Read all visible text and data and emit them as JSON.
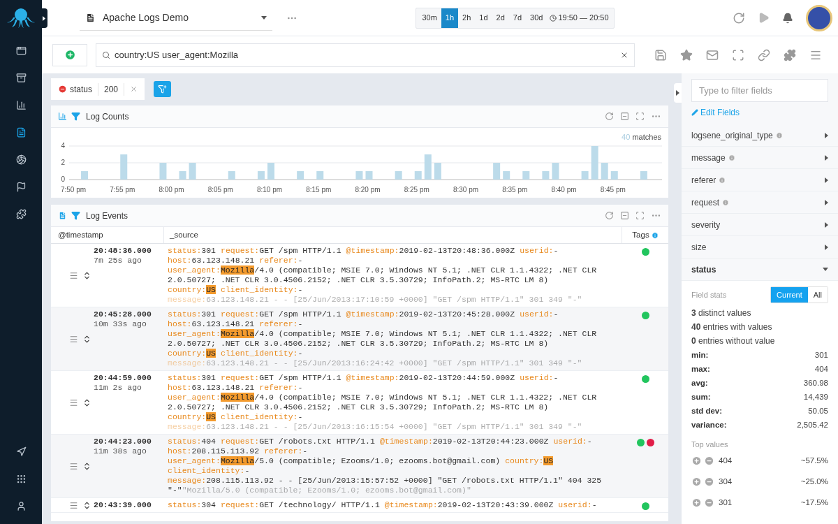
{
  "nav_top": [
    {
      "selected": false
    },
    {
      "selected": false
    },
    {
      "selected": false
    },
    {
      "selected": true
    },
    {
      "selected": false
    },
    {
      "selected": false
    },
    {
      "selected": false
    }
  ],
  "nav_bottom": [
    {
      "selected": false
    },
    {
      "selected": false
    },
    {
      "selected": false
    }
  ],
  "dashboard": {
    "title": "Apache Logs Demo"
  },
  "time_ranges": [
    {
      "label": "30m",
      "selected": false
    },
    {
      "label": "1h",
      "selected": true
    },
    {
      "label": "2h",
      "selected": false
    },
    {
      "label": "1d",
      "selected": false
    },
    {
      "label": "2d",
      "selected": false
    },
    {
      "label": "7d",
      "selected": false
    },
    {
      "label": "30d",
      "selected": false
    }
  ],
  "time_window": "19:50 — 20:50",
  "search": {
    "value": "country:US user_agent:Mozilla"
  },
  "filters": [
    {
      "field": "status",
      "value": "200",
      "excluded": true
    }
  ],
  "log_counts": {
    "title": "Log Counts",
    "matches_count": "40",
    "matches_label": "matches",
    "chart_data": {
      "type": "bar",
      "categories": [
        "7:50 pm",
        null,
        null,
        null,
        null,
        "7:55 pm",
        null,
        null,
        null,
        null,
        "8:00 pm",
        null,
        null,
        null,
        null,
        "8:05 pm",
        null,
        null,
        null,
        null,
        "8:10 pm",
        null,
        null,
        null,
        null,
        "8:15 pm",
        null,
        null,
        null,
        null,
        "8:20 pm",
        null,
        null,
        null,
        null,
        "8:25 pm",
        null,
        null,
        null,
        null,
        "8:30 pm",
        null,
        null,
        null,
        null,
        "8:35 pm",
        null,
        null,
        null,
        null,
        "8:40 pm",
        null,
        null,
        null,
        null,
        "8:45 pm",
        null,
        null,
        null,
        null
      ],
      "values": [
        0,
        1,
        0,
        0,
        0,
        3,
        0,
        0,
        0,
        2,
        0,
        1,
        2,
        0,
        0,
        0,
        1,
        0,
        0,
        1,
        2,
        0,
        0,
        1,
        0,
        1,
        0,
        0,
        0,
        1,
        1,
        0,
        0,
        1,
        0,
        1,
        3,
        2,
        0,
        0,
        0,
        0,
        0,
        2,
        1,
        0,
        1,
        0,
        1,
        2,
        0,
        0,
        1,
        4,
        2,
        1,
        0,
        0,
        1,
        0
      ],
      "ylim": [
        0,
        4
      ],
      "yticks": [
        0,
        2,
        4
      ]
    }
  },
  "log_events": {
    "title": "Log Events",
    "columns": [
      "@timestamp",
      "_source",
      "Tags"
    ],
    "rows": [
      {
        "time": "20:48:36.000",
        "ago": "7m 25s ago",
        "tags": [
          {
            "color": "#22c55e"
          }
        ],
        "fields": [
          {
            "key": "status:",
            "parts": [
              {
                "text": "301"
              }
            ]
          },
          {
            "key": "request:",
            "parts": [
              {
                "text": "GET /spm HTTP/1.1"
              }
            ]
          },
          {
            "key": "@timestamp:",
            "parts": [
              {
                "text": "2019-02-13T20:48:36.000Z"
              }
            ]
          },
          {
            "key": "userid:",
            "parts": [
              {
                "text": "-"
              }
            ]
          },
          {
            "key": "host:",
            "parts": [
              {
                "text": "63.123.148.21"
              }
            ]
          },
          {
            "key": "referer:",
            "parts": [
              {
                "text": "-"
              }
            ]
          },
          {
            "key": "user_agent:",
            "parts": [
              {
                "text": "Mozilla",
                "highlighted": true
              },
              {
                "text": "/4.0 (compatible; MSIE 7.0; Windows NT 5.1; .NET CLR 1.1.4322; .NET CLR 2.0.50727; .NET CLR 3.0.4506.2152; .NET CLR 3.5.30729; InfoPath.2; MS-RTC LM 8)"
              }
            ]
          },
          {
            "key": "country:",
            "parts": [
              {
                "text": "US",
                "highlighted": true
              }
            ]
          },
          {
            "key": "client_identity:",
            "parts": [
              {
                "text": "-"
              }
            ]
          },
          {
            "key": "message:",
            "faded": true,
            "parts": [
              {
                "text": "63.123.148.21 - - [25/Jun/2013:17:10:59 +0000] \"GET /spm HTTP/1.1\" 301 349 \"-\""
              }
            ]
          }
        ]
      },
      {
        "time": "20:45:28.000",
        "ago": "10m 33s ago",
        "tags": [
          {
            "color": "#22c55e"
          }
        ],
        "fields": [
          {
            "key": "status:",
            "parts": [
              {
                "text": "301"
              }
            ]
          },
          {
            "key": "request:",
            "parts": [
              {
                "text": "GET /spm HTTP/1.1"
              }
            ]
          },
          {
            "key": "@timestamp:",
            "parts": [
              {
                "text": "2019-02-13T20:45:28.000Z"
              }
            ]
          },
          {
            "key": "userid:",
            "parts": [
              {
                "text": "-"
              }
            ]
          },
          {
            "key": "host:",
            "parts": [
              {
                "text": "63.123.148.21"
              }
            ]
          },
          {
            "key": "referer:",
            "parts": [
              {
                "text": "-"
              }
            ]
          },
          {
            "key": "user_agent:",
            "parts": [
              {
                "text": "Mozilla",
                "highlighted": true
              },
              {
                "text": "/4.0 (compatible; MSIE 7.0; Windows NT 5.1; .NET CLR 1.1.4322; .NET CLR 2.0.50727; .NET CLR 3.0.4506.2152; .NET CLR 3.5.30729; InfoPath.2; MS-RTC LM 8)"
              }
            ]
          },
          {
            "key": "country:",
            "parts": [
              {
                "text": "US",
                "highlighted": true
              }
            ]
          },
          {
            "key": "client_identity:",
            "parts": [
              {
                "text": "-"
              }
            ]
          },
          {
            "key": "message:",
            "faded": true,
            "parts": [
              {
                "text": "63.123.148.21 - - [25/Jun/2013:16:24:42 +0000] \"GET /spm HTTP/1.1\" 301 349 \"-\""
              }
            ]
          }
        ]
      },
      {
        "time": "20:44:59.000",
        "ago": "11m 2s ago",
        "tags": [
          {
            "color": "#22c55e"
          }
        ],
        "fields": [
          {
            "key": "status:",
            "parts": [
              {
                "text": "301"
              }
            ]
          },
          {
            "key": "request:",
            "parts": [
              {
                "text": "GET /spm HTTP/1.1"
              }
            ]
          },
          {
            "key": "@timestamp:",
            "parts": [
              {
                "text": "2019-02-13T20:44:59.000Z"
              }
            ]
          },
          {
            "key": "userid:",
            "parts": [
              {
                "text": "-"
              }
            ]
          },
          {
            "key": "host:",
            "parts": [
              {
                "text": "63.123.148.21"
              }
            ]
          },
          {
            "key": "referer:",
            "parts": [
              {
                "text": "-"
              }
            ]
          },
          {
            "key": "user_agent:",
            "parts": [
              {
                "text": "Mozilla",
                "highlighted": true
              },
              {
                "text": "/4.0 (compatible; MSIE 7.0; Windows NT 5.1; .NET CLR 1.1.4322; .NET CLR 2.0.50727; .NET CLR 3.0.4506.2152; .NET CLR 3.5.30729; InfoPath.2; MS-RTC LM 8)"
              }
            ]
          },
          {
            "key": "country:",
            "parts": [
              {
                "text": "US",
                "highlighted": true
              }
            ]
          },
          {
            "key": "client_identity:",
            "parts": [
              {
                "text": "-"
              }
            ]
          },
          {
            "key": "message:",
            "faded": true,
            "parts": [
              {
                "text": "63.123.148.21 - - [25/Jun/2013:16:15:54 +0000] \"GET /spm HTTP/1.1\" 301 349 \"-\""
              }
            ]
          }
        ]
      },
      {
        "time": "20:44:23.000",
        "ago": "11m 38s ago",
        "tags": [
          {
            "color": "#22c55e"
          },
          {
            "color": "#e11d48"
          }
        ],
        "fields": [
          {
            "key": "status:",
            "parts": [
              {
                "text": "404"
              }
            ]
          },
          {
            "key": "request:",
            "parts": [
              {
                "text": "GET /robots.txt HTTP/1.1"
              }
            ]
          },
          {
            "key": "@timestamp:",
            "parts": [
              {
                "text": "2019-02-13T20:44:23.000Z"
              }
            ]
          },
          {
            "key": "userid:",
            "parts": [
              {
                "text": "-"
              }
            ]
          },
          {
            "key": "host:",
            "parts": [
              {
                "text": "208.115.113.92"
              }
            ]
          },
          {
            "key": "referer:",
            "parts": [
              {
                "text": "-"
              }
            ]
          },
          {
            "key": "user_agent:",
            "parts": [
              {
                "text": "Mozilla",
                "highlighted": true
              },
              {
                "text": "/5.0 (compatible; Ezooms/1.0; ezooms.bot@gmail.com)"
              }
            ]
          },
          {
            "key": "country:",
            "parts": [
              {
                "text": "US",
                "highlighted": true
              }
            ]
          },
          {
            "key": "client_identity:",
            "parts": [
              {
                "text": "-"
              }
            ]
          },
          {
            "key": "message:",
            "parts": [
              {
                "text": "208.115.113.92 - - [25/Jun/2013:15:57:52 +0000] \"GET /robots.txt HTTP/1.1\" 404 325 \"-\""
              },
              {
                "text": "\"Mozilla/5.0 (compatible; Ezooms/1.0; ezooms.bot@gmail.com)\"",
                "faded": true
              }
            ]
          }
        ]
      },
      {
        "time": "20:43:39.000",
        "tags": [
          {
            "color": "#22c55e"
          }
        ],
        "fields": [
          {
            "key": "status:",
            "parts": [
              {
                "text": "304"
              }
            ]
          },
          {
            "key": "request:",
            "parts": [
              {
                "text": "GET /technology/ HTTP/1.1"
              }
            ]
          },
          {
            "key": "@timestamp:",
            "parts": [
              {
                "text": "2019-02-13T20:43:39.000Z"
              }
            ]
          },
          {
            "key": "userid:",
            "parts": [
              {
                "text": "-"
              }
            ]
          }
        ]
      }
    ]
  },
  "fields_panel": {
    "filter_placeholder": "Type to filter fields",
    "edit_link": "Edit Fields",
    "fields": [
      {
        "name": "logsene_original_type",
        "info": true,
        "expanded": false
      },
      {
        "name": "message",
        "info": true,
        "expanded": false
      },
      {
        "name": "referer",
        "info": true,
        "expanded": false
      },
      {
        "name": "request",
        "info": true,
        "expanded": false
      },
      {
        "name": "severity",
        "info": false,
        "expanded": false
      },
      {
        "name": "size",
        "info": false,
        "expanded": false
      },
      {
        "name": "status",
        "info": false,
        "expanded": true
      }
    ],
    "stats": {
      "title": "Field stats",
      "scopes": [
        {
          "label": "Current",
          "selected": true
        },
        {
          "label": "All",
          "selected": false
        }
      ],
      "counts": [
        "**3** distinct values",
        "**40** entries with values",
        "**0** entries without value"
      ],
      "metrics": [
        {
          "label": "min:",
          "value": "301"
        },
        {
          "label": "max:",
          "value": "404"
        },
        {
          "label": "avg:",
          "value": "360.98"
        },
        {
          "label": "sum:",
          "value": "14,439"
        },
        {
          "label": "std dev:",
          "value": "50.05"
        },
        {
          "label": "variance:",
          "value": "2,505.42"
        }
      ],
      "top_title": "Top values",
      "top_values": [
        {
          "value": "404",
          "share": "~57.5%"
        },
        {
          "value": "304",
          "share": "~25.0%"
        },
        {
          "value": "301",
          "share": "~17.5%"
        }
      ]
    }
  }
}
